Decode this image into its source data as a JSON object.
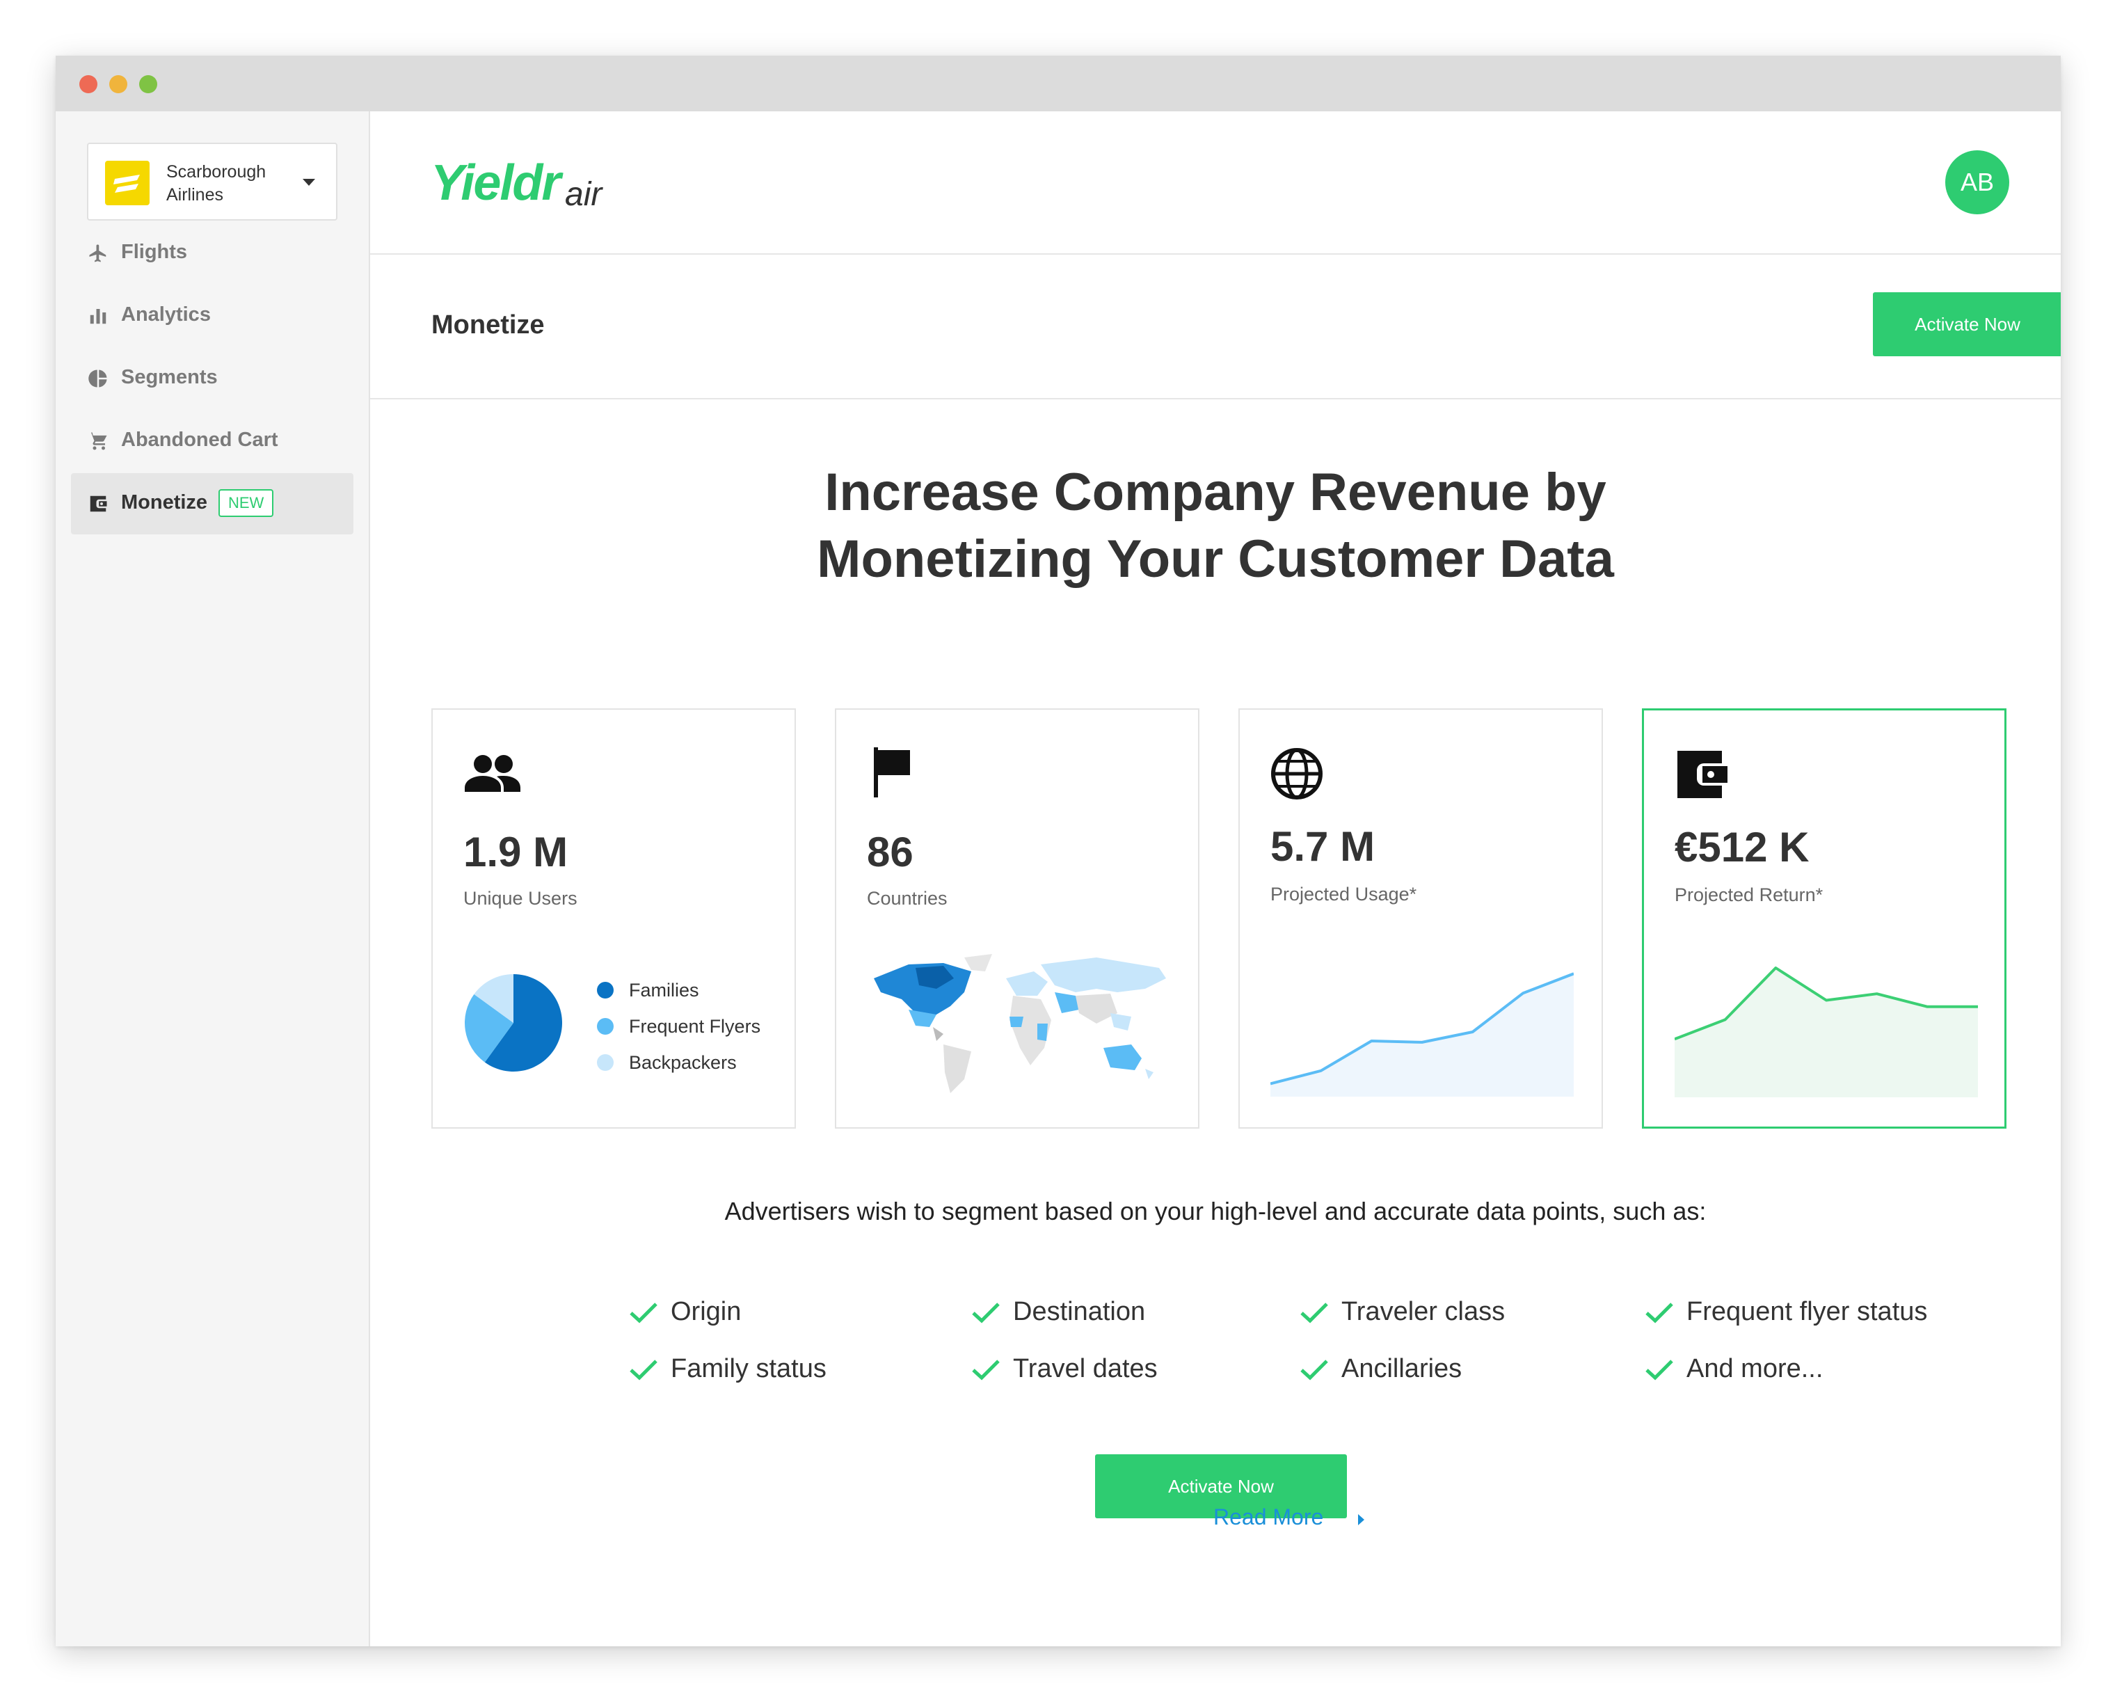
{
  "window": {
    "controls": [
      {
        "name": "close",
        "color": "#ee6a55"
      },
      {
        "name": "minimize",
        "color": "#f0b43c"
      },
      {
        "name": "maximize",
        "color": "#7fc344"
      }
    ]
  },
  "sidebar": {
    "account": {
      "name": "Scarborough Airlines",
      "logo_color": "#f5d800"
    },
    "items": [
      {
        "label": "Flights",
        "icon": "airplane-icon"
      },
      {
        "label": "Analytics",
        "icon": "bar-chart-icon"
      },
      {
        "label": "Segments",
        "icon": "pie-chart-icon"
      },
      {
        "label": "Abandoned Cart",
        "icon": "shopping-cart-icon"
      },
      {
        "label": "Monetize",
        "icon": "wallet-icon",
        "badge": "NEW",
        "active": true
      }
    ]
  },
  "header": {
    "logo_main": "Yieldr",
    "logo_sub": "air",
    "avatar_initials": "AB"
  },
  "subheader": {
    "title": "Monetize",
    "activate_label": "Activate Now"
  },
  "headline": {
    "line1": "Increase Company Revenue by",
    "line2": "Monetizing Your Customer Data"
  },
  "cards": [
    {
      "icon": "users-icon",
      "value": "1.9 M",
      "label": "Unique Users"
    },
    {
      "icon": "flag-icon",
      "value": "86",
      "label": "Countries"
    },
    {
      "icon": "globe-icon",
      "value": "5.7 M",
      "label": "Projected Usage*"
    },
    {
      "icon": "wallet-icon",
      "value": "€512 K",
      "label": "Projected Return*"
    }
  ],
  "chart_data": [
    {
      "type": "pie",
      "labels": [
        "Families",
        "Frequent Flyers",
        "Backpackers"
      ],
      "values": [
        60,
        25,
        15
      ],
      "colors": [
        "#0a73c4",
        "#5bbcf5",
        "#c7e6fb"
      ]
    },
    {
      "type": "area",
      "x": [
        0,
        1,
        2,
        3,
        4,
        5,
        6
      ],
      "values": [
        10,
        20,
        43,
        42,
        50,
        80,
        95
      ],
      "ylim": [
        0,
        100
      ],
      "color": "#5bbcf5",
      "fill": "#eef6fd"
    },
    {
      "type": "area",
      "x": [
        0,
        1,
        2,
        3,
        4,
        5,
        6
      ],
      "values": [
        45,
        60,
        100,
        75,
        80,
        70,
        70
      ],
      "ylim": [
        0,
        100
      ],
      "color": "#3ccf74",
      "fill": "#edf8f1"
    }
  ],
  "intro_text": "Advertisers wish to segment based on your high-level and accurate data points, such as:",
  "features": [
    "Origin",
    "Destination",
    "Traveler class",
    "Frequent flyer status",
    "Family status",
    "Travel dates",
    "Ancillaries",
    "And more..."
  ],
  "cta": {
    "label": "Activate Now"
  },
  "read_more": "Read More",
  "colors": {
    "accent": "#2ecc71",
    "link": "#1a8fd8"
  }
}
